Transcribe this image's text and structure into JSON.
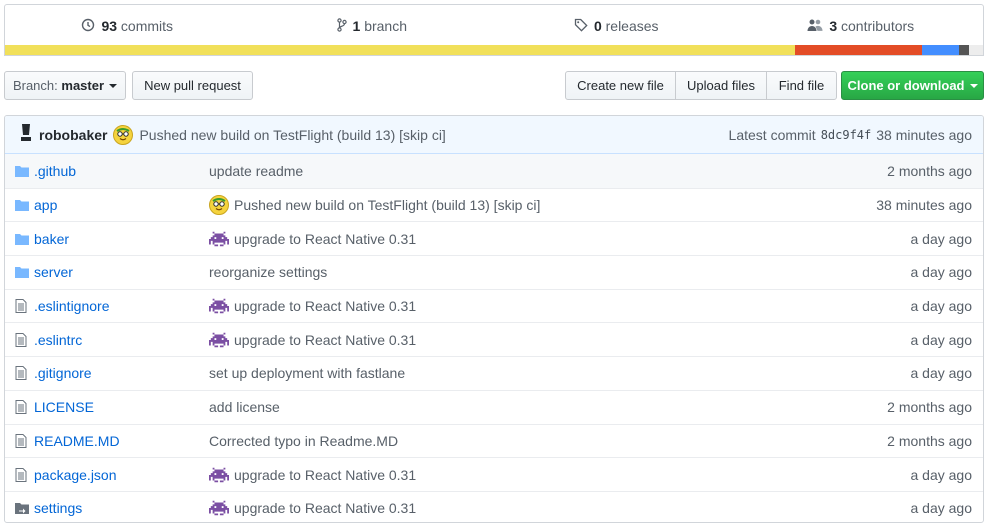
{
  "summary": {
    "commits_count": "93",
    "commits_label": "commits",
    "branch_count": "1",
    "branch_label": "branch",
    "releases_count": "0",
    "releases_label": "releases",
    "contributors_count": "3",
    "contributors_label": "contributors"
  },
  "language_colors": [
    "#f1e05a",
    "#e34c26",
    "#438eff",
    "#555555",
    "#ededed"
  ],
  "toolbar": {
    "branch_prefix": "Branch:",
    "branch_name": "master",
    "new_pr": "New pull request",
    "create_file": "Create new file",
    "upload_files": "Upload files",
    "find_file": "Find file",
    "clone": "Clone or download"
  },
  "latest_commit": {
    "author": "robobaker",
    "message": "Pushed new build on TestFlight (build 13) [skip ci]",
    "label": "Latest commit",
    "sha": "8dc9f4f",
    "age": "38 minutes ago"
  },
  "files": [
    {
      "type": "folder",
      "name": ".github",
      "message": "update readme",
      "age": "2 months ago",
      "emoji": ""
    },
    {
      "type": "folder",
      "name": "app",
      "message": "Pushed new build on TestFlight (build 13) [skip ci]",
      "age": "38 minutes ago",
      "emoji": "face"
    },
    {
      "type": "folder",
      "name": "baker",
      "message": "upgrade to React Native 0.31",
      "age": "a day ago",
      "emoji": "invader"
    },
    {
      "type": "folder",
      "name": "server",
      "message": "reorganize settings",
      "age": "a day ago",
      "emoji": ""
    },
    {
      "type": "file",
      "name": ".eslintignore",
      "message": "upgrade to React Native 0.31",
      "age": "a day ago",
      "emoji": "invader"
    },
    {
      "type": "file",
      "name": ".eslintrc",
      "message": "upgrade to React Native 0.31",
      "age": "a day ago",
      "emoji": "invader"
    },
    {
      "type": "file",
      "name": ".gitignore",
      "message": "set up deployment with fastlane",
      "age": "a day ago",
      "emoji": ""
    },
    {
      "type": "file",
      "name": "LICENSE",
      "message": "add license",
      "age": "2 months ago",
      "emoji": ""
    },
    {
      "type": "file",
      "name": "README.MD",
      "message": "Corrected typo in Readme.MD",
      "age": "2 months ago",
      "emoji": ""
    },
    {
      "type": "file",
      "name": "package.json",
      "message": "upgrade to React Native 0.31",
      "age": "a day ago",
      "emoji": "invader"
    },
    {
      "type": "symlink-dir",
      "name": "settings",
      "message": "upgrade to React Native 0.31",
      "age": "a day ago",
      "emoji": "invader"
    }
  ]
}
